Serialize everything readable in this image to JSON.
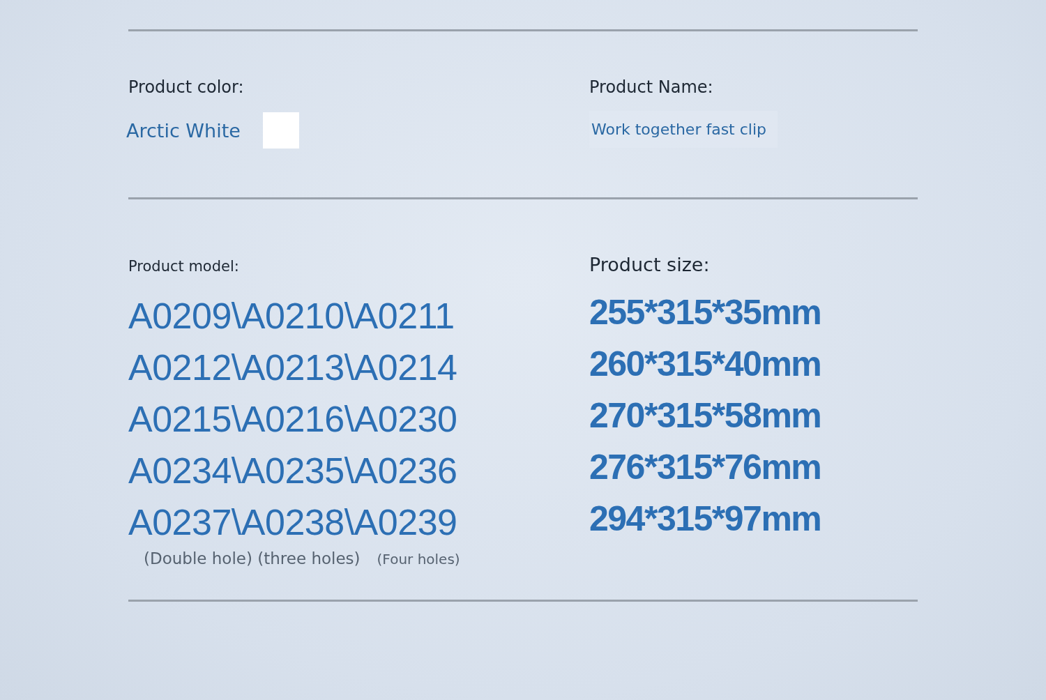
{
  "product_color": {
    "label": "Product color:",
    "value": "Arctic White"
  },
  "product_name": {
    "label": "Product Name:",
    "value": "Work together fast clip"
  },
  "product_model": {
    "label": "Product model:",
    "models": [
      "A0209\\A0210\\A0211",
      "A0212\\A0213\\A0214",
      "A0215\\A0216\\A0230",
      "A0234\\A0235\\A0236",
      "A0237\\A0238\\A0239"
    ],
    "notes": [
      "(Double hole) (three holes)",
      "(Four holes)"
    ]
  },
  "product_size": {
    "label": "Product size:",
    "sizes": [
      "255*315*35mm",
      "260*315*40mm",
      "270*315*58mm",
      "276*315*76mm",
      "294*315*97mm"
    ]
  }
}
